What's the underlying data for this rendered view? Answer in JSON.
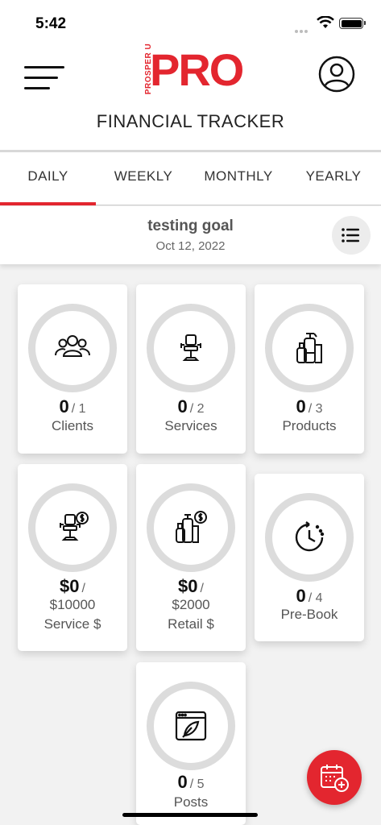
{
  "status": {
    "time": "5:42"
  },
  "header": {
    "logo_small": "PROSPER U",
    "logo_big": "PRO",
    "title": "FINANCIAL TRACKER"
  },
  "tabs": [
    {
      "label": "DAILY",
      "active": true
    },
    {
      "label": "WEEKLY",
      "active": false
    },
    {
      "label": "MONTHLY",
      "active": false
    },
    {
      "label": "YEARLY",
      "active": false
    }
  ],
  "goal": {
    "title": "testing goal",
    "date": "Oct 12, 2022"
  },
  "cards": {
    "clients": {
      "value": "0",
      "target": "/ 1",
      "label": "Clients",
      "icon": "people-icon"
    },
    "services": {
      "value": "0",
      "target": "/ 2",
      "label": "Services",
      "icon": "salon-chair-icon"
    },
    "products": {
      "value": "0",
      "target": "/ 3",
      "label": "Products",
      "icon": "bottles-icon"
    },
    "service_dollars": {
      "value": "$0",
      "target": "/",
      "goal": "$10000",
      "label": "Service $",
      "icon": "salon-chair-dollar-icon"
    },
    "retail_dollars": {
      "value": "$0",
      "target": "/",
      "goal": "$2000",
      "label": "Retail $",
      "icon": "bottles-dollar-icon"
    },
    "prebook": {
      "value": "0",
      "target": "/ 4",
      "label": "Pre-Book",
      "icon": "clock-icon"
    },
    "posts": {
      "value": "0",
      "target": "/ 5",
      "label": "Posts",
      "icon": "browser-feather-icon"
    }
  },
  "colors": {
    "accent": "#e3262f",
    "ring": "#dcdcdc",
    "background": "#f2f2f2"
  }
}
